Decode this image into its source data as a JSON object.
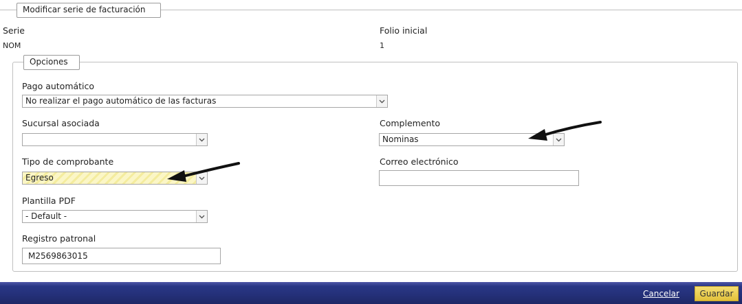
{
  "header": {
    "legend": "Modificar serie de facturación"
  },
  "summary": {
    "serie_label": "Serie",
    "serie_value": "NOM",
    "folio_label": "Folio inicial",
    "folio_value": "1"
  },
  "options": {
    "legend": "Opciones",
    "pago_label": "Pago automático",
    "pago_value": "No realizar el pago automático de las facturas",
    "sucursal_label": "Sucursal asociada",
    "sucursal_value": "",
    "complemento_label": "Complemento",
    "complemento_value": "Nominas",
    "tipo_label": "Tipo de comprobante",
    "tipo_value": "Egreso",
    "correo_label": "Correo electrónico",
    "correo_value": "",
    "plantilla_label": "Plantilla PDF",
    "plantilla_value": "- Default -",
    "registro_label": "Registro patronal",
    "registro_value": "M2569863015"
  },
  "footer": {
    "cancel_label": "Cancelar",
    "save_label": "Guardar"
  },
  "icons": {
    "dropdown": "chevron-down-icon",
    "annotation": "arrow-annotation-icon"
  },
  "colors": {
    "footer_bg": "#243078",
    "save_bg": "#e8c94a",
    "highlight_bg": "#fbf6c6"
  }
}
